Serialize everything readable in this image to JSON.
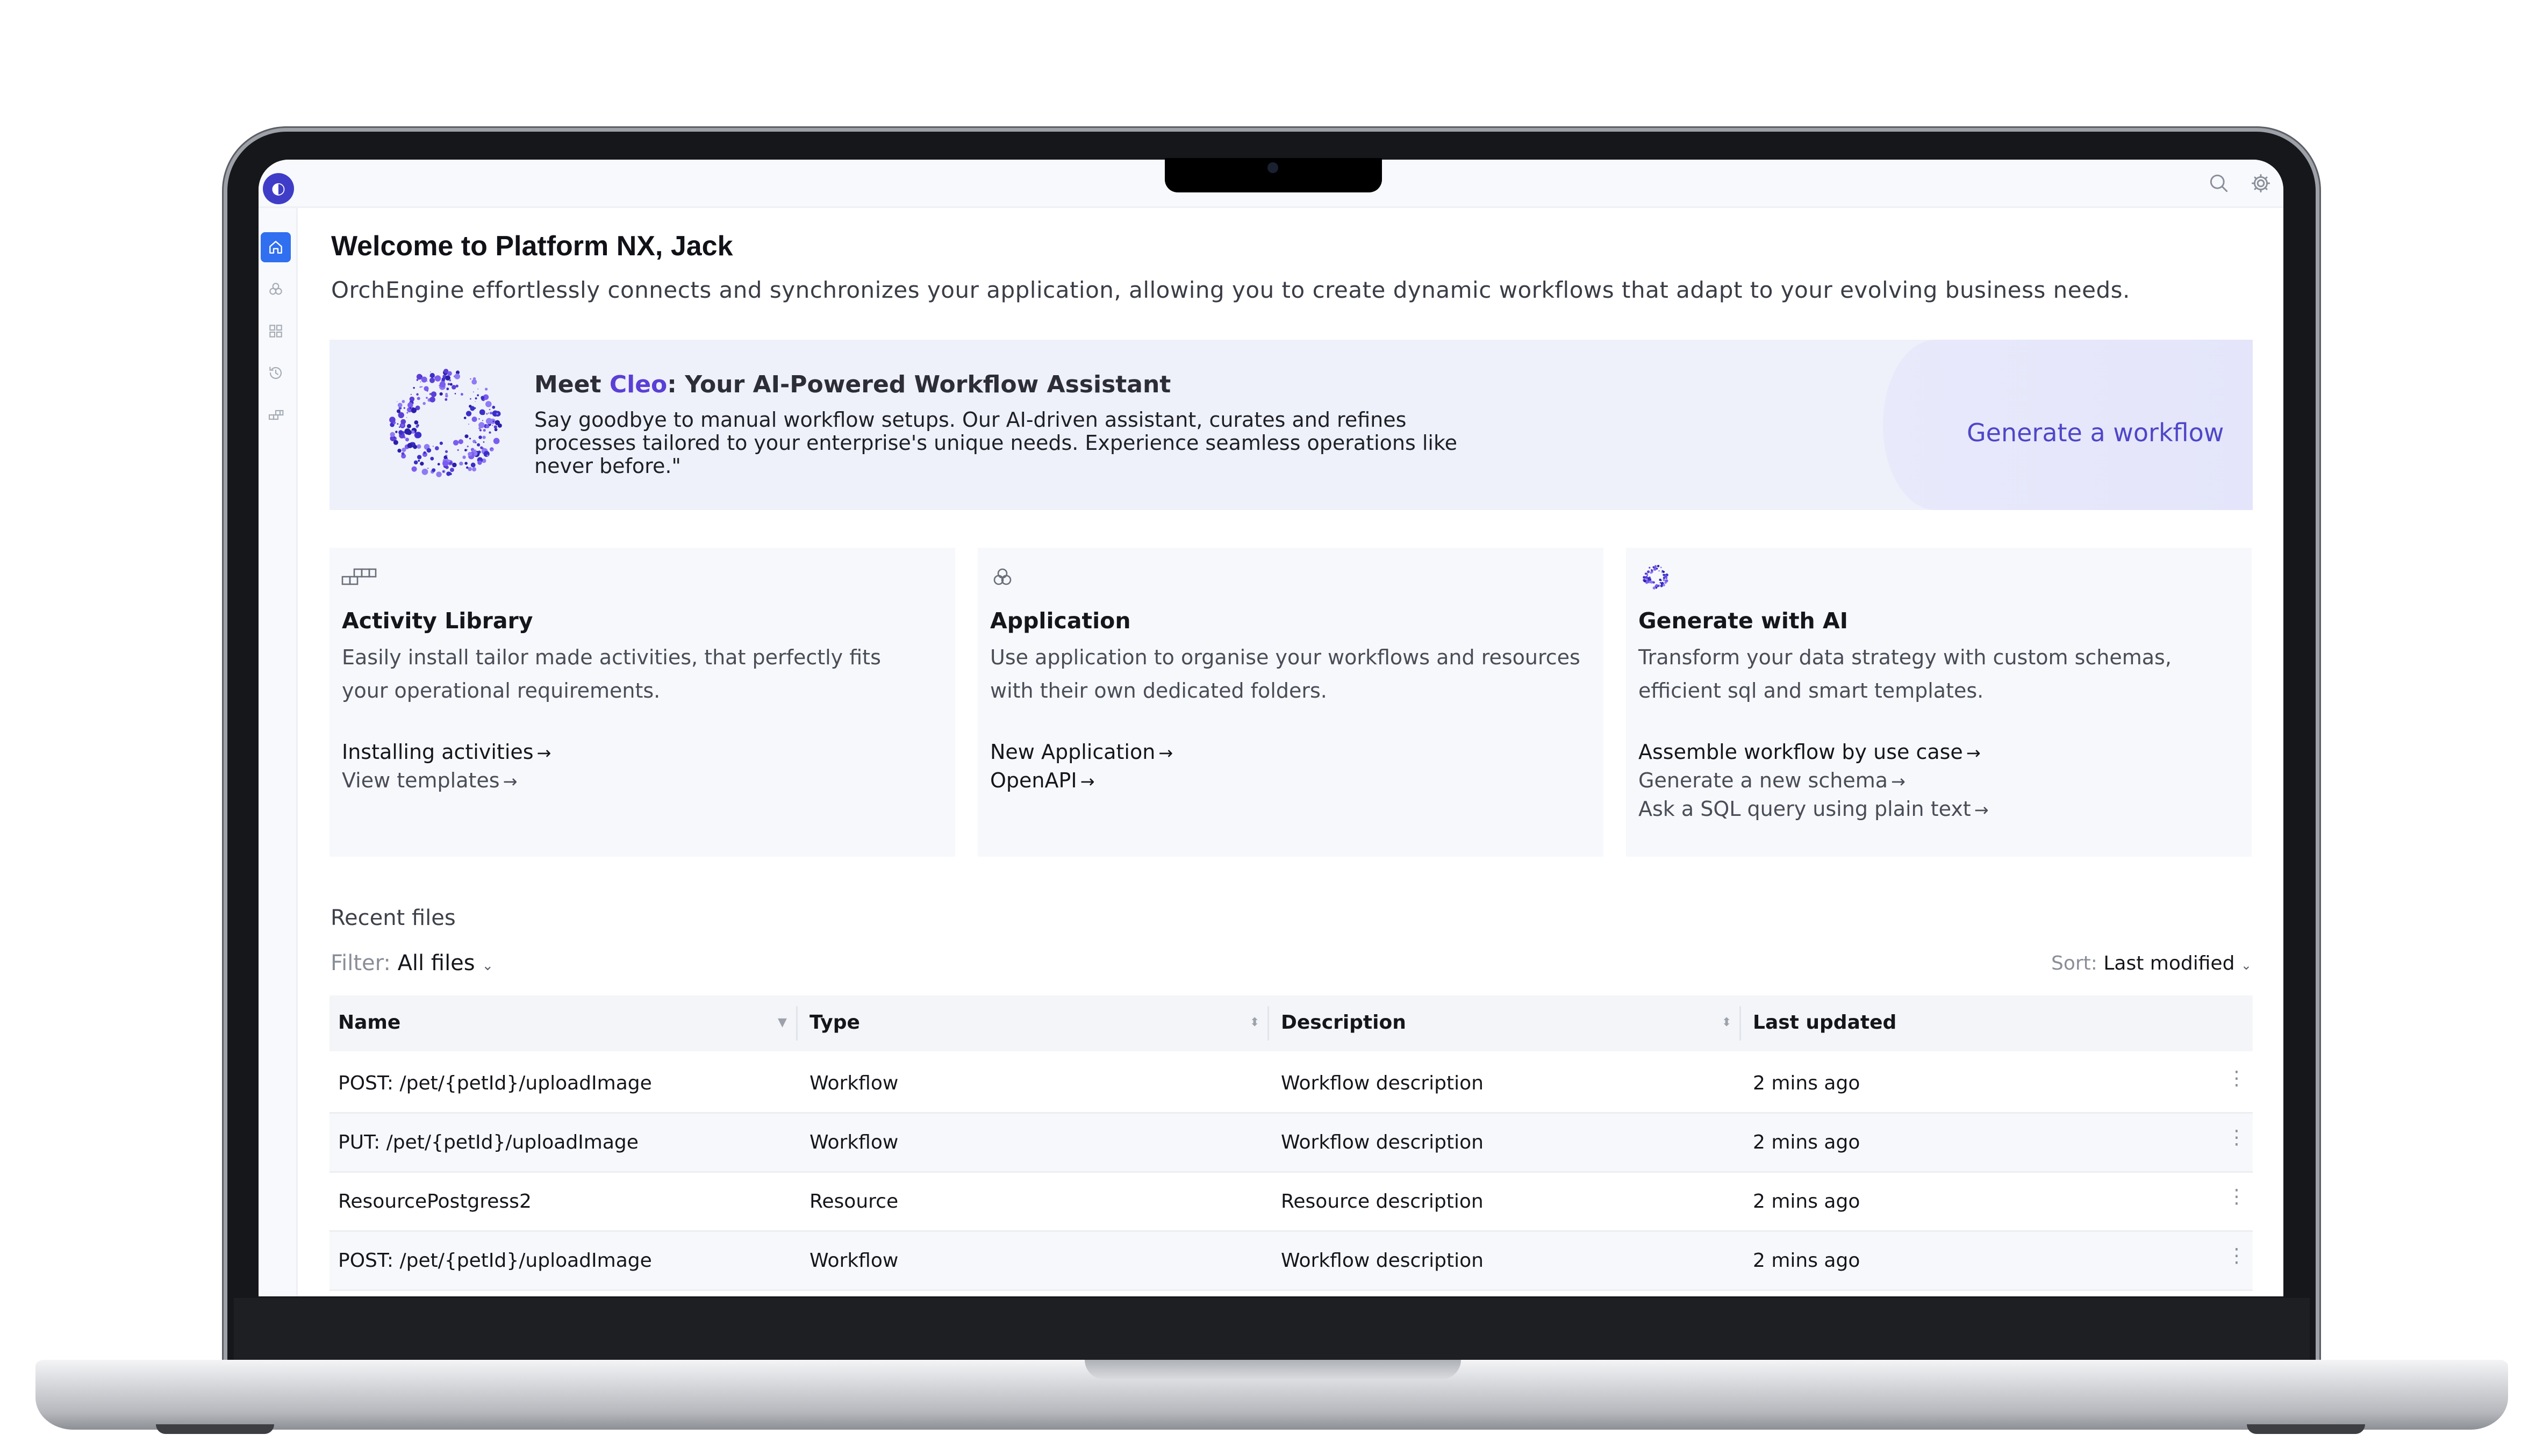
{
  "header": {
    "logo_glyph": "◐",
    "icons": [
      "search-icon",
      "gear-icon"
    ]
  },
  "sidebar": {
    "items": [
      {
        "name": "home",
        "icon": "home-icon",
        "active": true
      },
      {
        "name": "applications",
        "icon": "circles-icon",
        "active": false
      },
      {
        "name": "dashboard",
        "icon": "grid-icon",
        "active": false
      },
      {
        "name": "history",
        "icon": "history-icon",
        "active": false
      },
      {
        "name": "activities",
        "icon": "blocks-icon",
        "active": false
      }
    ]
  },
  "main": {
    "title": "Welcome to Platform NX, Jack",
    "subtitle": "OrchEngine effortlessly connects and synchronizes your application, allowing you to create dynamic workflows that adapt to your evolving business needs.",
    "hero": {
      "title_prefix": "Meet ",
      "title_brand": "Cleo",
      "title_suffix": ": Your AI-Powered Workflow Assistant",
      "text": "Say goodbye to manual workflow setups. Our AI-driven assistant, curates and refines processes tailored to your enterprise's unique needs. Experience seamless operations like never before.\"",
      "cta": "Generate a workflow"
    },
    "cards": [
      {
        "title": "Activity Library",
        "desc": "Easily install tailor made activities, that perfectly fits your operational requirements.",
        "links": [
          "Installing activities",
          "View templates"
        ]
      },
      {
        "title": "Application",
        "desc": "Use application to organise your workflows and resources with their own dedicated folders.",
        "links": [
          "New Application",
          "OpenAPI"
        ]
      },
      {
        "title": "Generate with AI",
        "desc": "Transform your data strategy with custom schemas, efficient sql and smart templates.",
        "links": [
          "Assemble workflow by use case",
          "Generate a new schema",
          "Ask a SQL query using plain text"
        ]
      }
    ],
    "recent": {
      "title": "Recent files",
      "filter_label": "Filter:",
      "filter_value": "All files",
      "sort_label": "Sort:",
      "sort_value": "Last modified",
      "columns": [
        "Name",
        "Type",
        "Description",
        "Last updated"
      ],
      "rows": [
        {
          "name": "POST:  /pet/{petId}/uploadImage",
          "type": "Workflow",
          "desc": "Workflow description",
          "updated": "2 mins ago"
        },
        {
          "name": "PUT:  /pet/{petId}/uploadImage",
          "type": "Workflow",
          "desc": "Workflow description",
          "updated": "2 mins ago"
        },
        {
          "name": "ResourcePostgress2",
          "type": "Resource",
          "desc": "Resource description",
          "updated": "2 mins ago"
        },
        {
          "name": "POST:  /pet/{petId}/uploadImage",
          "type": "Workflow",
          "desc": "Workflow description",
          "updated": "2 mins ago"
        }
      ]
    }
  },
  "colors": {
    "accent": "#2f6ff0",
    "brand": "#5b3fd6",
    "cta": "#4f46c8"
  }
}
